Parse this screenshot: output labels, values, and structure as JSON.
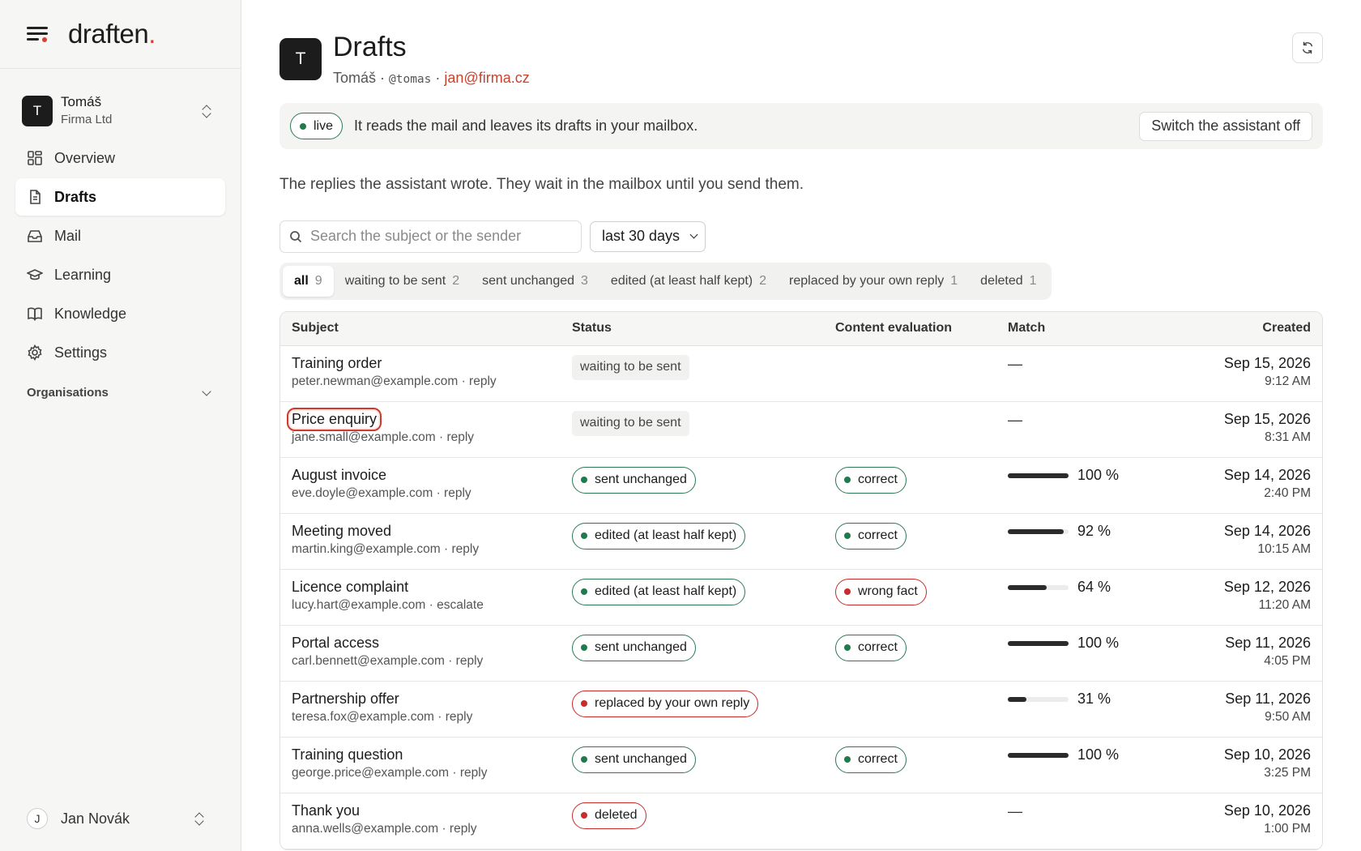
{
  "brand": {
    "logo_text": "draften",
    "logo_dot": "."
  },
  "account": {
    "initial": "T",
    "name": "Tomáš",
    "org": "Firma Ltd"
  },
  "nav": [
    {
      "label": "Overview",
      "icon": "grid-icon",
      "active": false
    },
    {
      "label": "Drafts",
      "icon": "document-icon",
      "active": true
    },
    {
      "label": "Mail",
      "icon": "inbox-icon",
      "active": false
    },
    {
      "label": "Learning",
      "icon": "graduation-cap-icon",
      "active": false
    },
    {
      "label": "Knowledge",
      "icon": "book-icon",
      "active": false
    },
    {
      "label": "Settings",
      "icon": "gear-icon",
      "active": false
    }
  ],
  "organisations_label": "Organisations",
  "footer_user": {
    "initial": "J",
    "name": "Jan Novák"
  },
  "header": {
    "initial": "T",
    "title": "Drafts",
    "name": "Tomáš",
    "sep1": " · ",
    "handle": "@tomas",
    "sep2": " · ",
    "email": "jan@firma.cz"
  },
  "banner": {
    "status": "live",
    "text": "It reads the mail and leaves its drafts in your mailbox.",
    "button": "Switch the assistant off"
  },
  "description": "The replies the assistant wrote. They wait in the mailbox until you send them.",
  "search": {
    "placeholder": "Search the subject or the sender",
    "value": ""
  },
  "period": {
    "selected": "last 30 days"
  },
  "tabs": [
    {
      "label": "all",
      "count": "9",
      "active": true
    },
    {
      "label": "waiting to be sent",
      "count": "2",
      "active": false
    },
    {
      "label": "sent unchanged",
      "count": "3",
      "active": false
    },
    {
      "label": "edited (at least half kept)",
      "count": "2",
      "active": false
    },
    {
      "label": "replaced by your own reply",
      "count": "1",
      "active": false
    },
    {
      "label": "deleted",
      "count": "1",
      "active": false
    }
  ],
  "table": {
    "columns": {
      "subject": "Subject",
      "status": "Status",
      "evaluation": "Content evaluation",
      "match": "Match",
      "created": "Created"
    },
    "rows": [
      {
        "subject": "Training order",
        "meta": "peter.newman@example.com · reply",
        "status": "waiting to be sent",
        "status_style": "plain",
        "evaluation": "",
        "eval_style": "",
        "match": null,
        "match_text": "—",
        "date": "Sep 15, 2026",
        "time": "9:12 AM",
        "highlight": false
      },
      {
        "subject": "Price enquiry",
        "meta": "jane.small@example.com · reply",
        "status": "waiting to be sent",
        "status_style": "plain",
        "evaluation": "",
        "eval_style": "",
        "match": null,
        "match_text": "—",
        "date": "Sep 15, 2026",
        "time": "8:31 AM",
        "highlight": true
      },
      {
        "subject": "August invoice",
        "meta": "eve.doyle@example.com · reply",
        "status": "sent unchanged",
        "status_style": "green",
        "evaluation": "correct",
        "eval_style": "green",
        "match": 100,
        "match_text": "100 %",
        "date": "Sep 14, 2026",
        "time": "2:40 PM",
        "highlight": false
      },
      {
        "subject": "Meeting moved",
        "meta": "martin.king@example.com · reply",
        "status": "edited (at least half kept)",
        "status_style": "green",
        "evaluation": "correct",
        "eval_style": "green",
        "match": 92,
        "match_text": "92 %",
        "date": "Sep 14, 2026",
        "time": "10:15 AM",
        "highlight": false
      },
      {
        "subject": "Licence complaint",
        "meta": "lucy.hart@example.com · escalate",
        "status": "edited (at least half kept)",
        "status_style": "green",
        "evaluation": "wrong fact",
        "eval_style": "red",
        "match": 64,
        "match_text": "64 %",
        "date": "Sep 12, 2026",
        "time": "11:20 AM",
        "highlight": false
      },
      {
        "subject": "Portal access",
        "meta": "carl.bennett@example.com · reply",
        "status": "sent unchanged",
        "status_style": "green",
        "evaluation": "correct",
        "eval_style": "green",
        "match": 100,
        "match_text": "100 %",
        "date": "Sep 11, 2026",
        "time": "4:05 PM",
        "highlight": false
      },
      {
        "subject": "Partnership offer",
        "meta": "teresa.fox@example.com · reply",
        "status": "replaced by your own reply",
        "status_style": "red",
        "evaluation": "",
        "eval_style": "",
        "match": 31,
        "match_text": "31 %",
        "date": "Sep 11, 2026",
        "time": "9:50 AM",
        "highlight": false
      },
      {
        "subject": "Training question",
        "meta": "george.price@example.com · reply",
        "status": "sent unchanged",
        "status_style": "green",
        "evaluation": "correct",
        "eval_style": "green",
        "match": 100,
        "match_text": "100 %",
        "date": "Sep 10, 2026",
        "time": "3:25 PM",
        "highlight": false
      },
      {
        "subject": "Thank you",
        "meta": "anna.wells@example.com · reply",
        "status": "deleted",
        "status_style": "red",
        "evaluation": "",
        "eval_style": "",
        "match": null,
        "match_text": "—",
        "date": "Sep 10, 2026",
        "time": "1:00 PM",
        "highlight": false
      }
    ]
  },
  "colors": {
    "accent": "#d6402c",
    "positive": "#1f7a4d",
    "negative": "#c92a2a",
    "dark": "#1c1c1c"
  }
}
